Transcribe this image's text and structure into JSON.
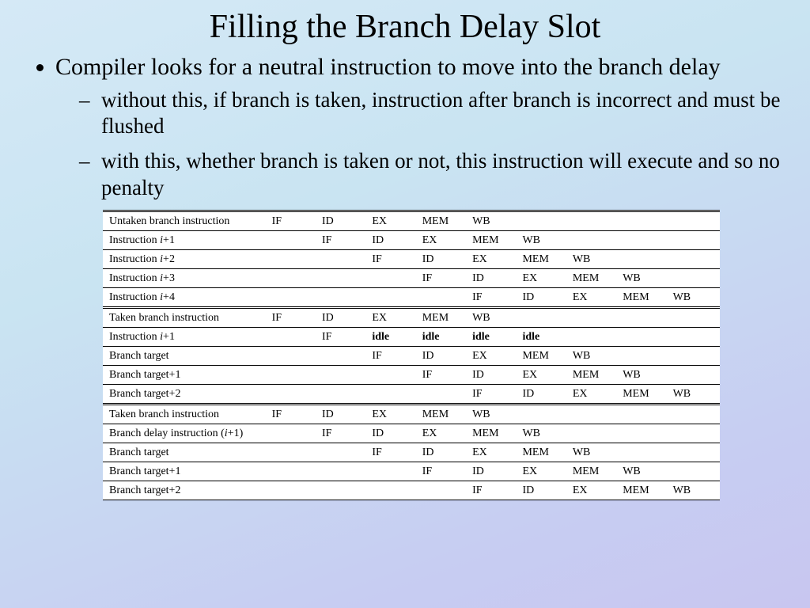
{
  "title": "Filling the Branch Delay Slot",
  "bullets": {
    "b1": "Compiler looks for a neutral instruction to move into the branch delay",
    "s1": "without this, if branch is taken, instruction after branch is incorrect and must be flushed",
    "s2": "with this, whether branch is taken or not, this instruction will execute and so no penalty"
  },
  "stages": {
    "IF": "IF",
    "ID": "ID",
    "EX": "EX",
    "MEM": "MEM",
    "WB": "WB",
    "idle": "idle"
  },
  "labels": {
    "untaken": "Untaken branch instruction",
    "taken": "Taken branch instruction",
    "inst_prefix": "Instruction ",
    "i": "i",
    "p1": "+1",
    "p2": "+2",
    "p3": "+3",
    "p4": "+4",
    "bt": "Branch target",
    "btp1": "Branch target+1",
    "btp2": "Branch target+2",
    "bdi_a": "Branch delay instruction (",
    "bdi_b": "+1)"
  }
}
